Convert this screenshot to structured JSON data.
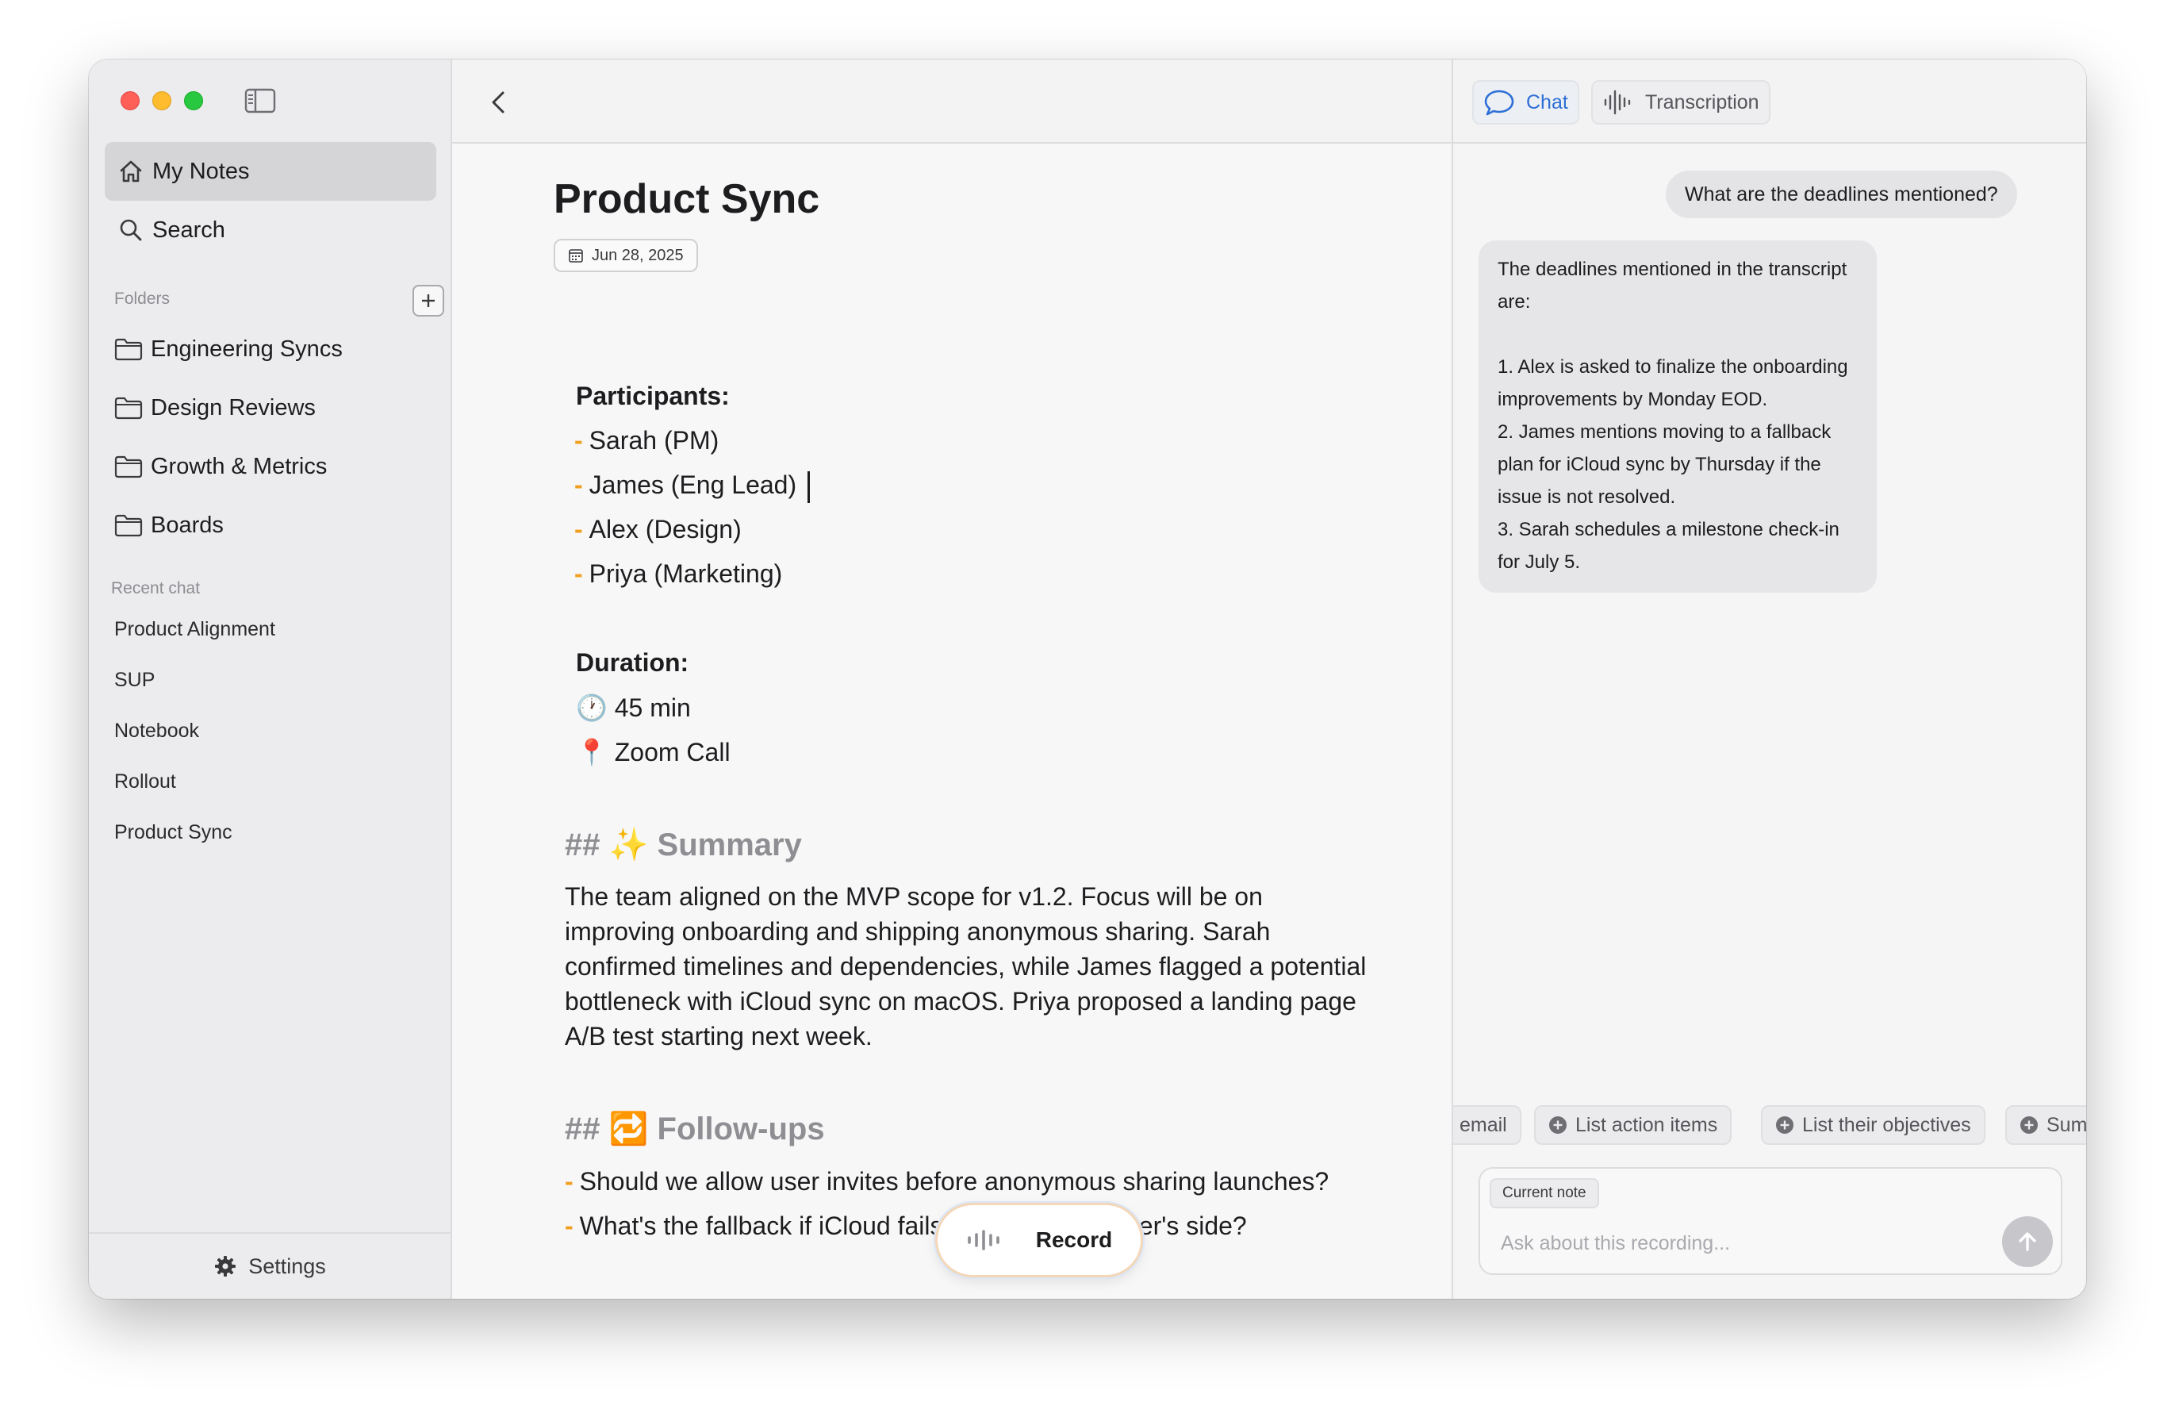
{
  "sidebar": {
    "nav": [
      {
        "label": "My Notes",
        "icon": "home-icon"
      },
      {
        "label": "Search",
        "icon": "search-icon"
      }
    ],
    "folders_label": "Folders",
    "folders": [
      {
        "label": "Engineering Syncs"
      },
      {
        "label": "Design Reviews"
      },
      {
        "label": "Growth & Metrics"
      },
      {
        "label": "Boards"
      }
    ],
    "recent_label": "Recent chat",
    "recent": [
      {
        "label": "Product Alignment"
      },
      {
        "label": "SUP"
      },
      {
        "label": "Notebook"
      },
      {
        "label": "Rollout"
      },
      {
        "label": "Product Sync"
      }
    ],
    "settings_label": "Settings"
  },
  "note": {
    "title": "Product Sync",
    "date": "Jun 28, 2025",
    "participants_label": "Participants:",
    "participants": [
      "Sarah (PM)",
      "James (Eng Lead)",
      "Alex (Design)",
      "Priya (Marketing)"
    ],
    "duration_label": "Duration:",
    "duration": "45 min",
    "location": "Zoom Call",
    "duration_emoji": "🕐",
    "location_emoji": "📍",
    "summary_heading": "## ✨ Summary",
    "summary": "The team aligned on the MVP scope for v1.2. Focus will be on improving onboarding and shipping anonymous sharing. Sarah confirmed timelines and dependencies, while James flagged a potential bottleneck with iCloud sync on macOS. Priya proposed a landing page A/B test starting next week.",
    "followups_heading": "## 🔁 Follow-ups",
    "followups": [
      "Should we allow user invites before anonymous sharing launches?",
      "What's the fallback if iCloud fails silently on the user's side?"
    ],
    "dash": "-",
    "record_label": "Record"
  },
  "chat": {
    "tabs": [
      {
        "label": "Chat",
        "icon": "chat-bubble-icon",
        "active": true
      },
      {
        "label": "Transcription",
        "icon": "waveform-icon",
        "active": false
      }
    ],
    "user_message": "What are the deadlines mentioned?",
    "ai_message": "The deadlines mentioned in the transcript are:\n\n1. Alex is asked to finalize the onboarding improvements by Monday EOD.\n2. James mentions moving to a fallback plan for iCloud sync by Thursday if the issue is not resolved.\n3. Sarah schedules a milestone check-in for July 5.",
    "suggestions": [
      "email",
      "List action items",
      "List their objectives",
      "Summ"
    ],
    "context_chip": "Current note",
    "input_placeholder": "Ask about this recording..."
  },
  "colors": {
    "accent": "#2d6fd6",
    "bullet_dash": "#f0a020",
    "traffic_red": "#fe5f57",
    "traffic_yellow": "#febc2e",
    "traffic_green": "#28c840"
  }
}
